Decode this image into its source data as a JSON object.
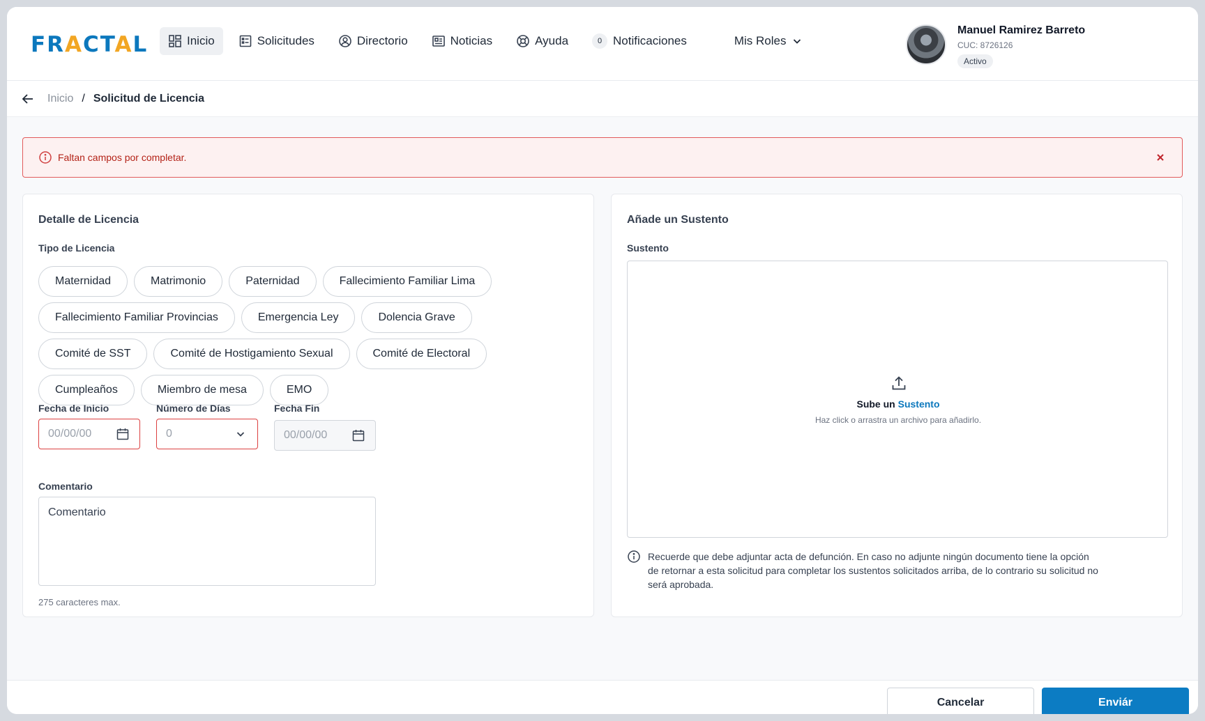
{
  "brand": {
    "logo_left": "FR",
    "logo_a1": "A",
    "logo_mid": "CT",
    "logo_a2": "A",
    "logo_right": "L"
  },
  "nav": {
    "items": [
      {
        "label": "Inicio"
      },
      {
        "label": "Solicitudes"
      },
      {
        "label": "Directorio"
      },
      {
        "label": "Noticias"
      },
      {
        "label": "Ayuda"
      }
    ],
    "notifications_count": "0",
    "notifications_label": "Notificaciones",
    "roles_label": "Mis Roles"
  },
  "user": {
    "name": "Manuel Ramirez Barreto",
    "cuc": "CUC: 8726126",
    "status": "Activo"
  },
  "breadcrumb": {
    "home": "Inicio",
    "separator": "/",
    "current": "Solicitud de Licencia"
  },
  "alert": {
    "message": "Faltan campos por completar."
  },
  "detail": {
    "title": "Detalle de Licencia",
    "type_label": "Tipo de Licencia",
    "types": [
      "Maternidad",
      "Matrimonio",
      "Paternidad",
      "Fallecimiento Familiar Lima",
      "Fallecimiento Familiar Provincias",
      "Emergencia Ley",
      "Dolencia Grave",
      "Comité de SST",
      "Comité de Hostigamiento Sexual",
      "Comité de Electoral",
      "Cumpleaños",
      "Miembro de mesa",
      "EMO"
    ],
    "start_label": "Fecha de Inicio",
    "start_placeholder": "00/00/00",
    "days_label": "Número de Días",
    "days_value": "0",
    "end_label": "Fecha Fin",
    "end_placeholder": "00/00/00",
    "comment_label": "Comentario",
    "comment_placeholder": "Comentario",
    "comment_hint": "275 caracteres max."
  },
  "support": {
    "title": "Añade un Sustento",
    "field_label": "Sustento",
    "upload_prefix": "Sube un",
    "upload_link": "Sustento",
    "upload_hint": "Haz click o arrastra un archivo para añadirlo.",
    "note": "Recuerde que debe adjuntar acta de defunción. En caso no adjunte ningún documento tiene la opción de retornar a esta solicitud para completar los sustentos solicitados arriba, de lo contrario su solicitud no será aprobada."
  },
  "footer": {
    "cancel_label": "Cancelar",
    "send_label": "Enviár"
  },
  "colors": {
    "primary": "#0c78bd",
    "accent": "#f2a623",
    "error": "#dc4040",
    "error_bg": "#fdf1f1"
  }
}
